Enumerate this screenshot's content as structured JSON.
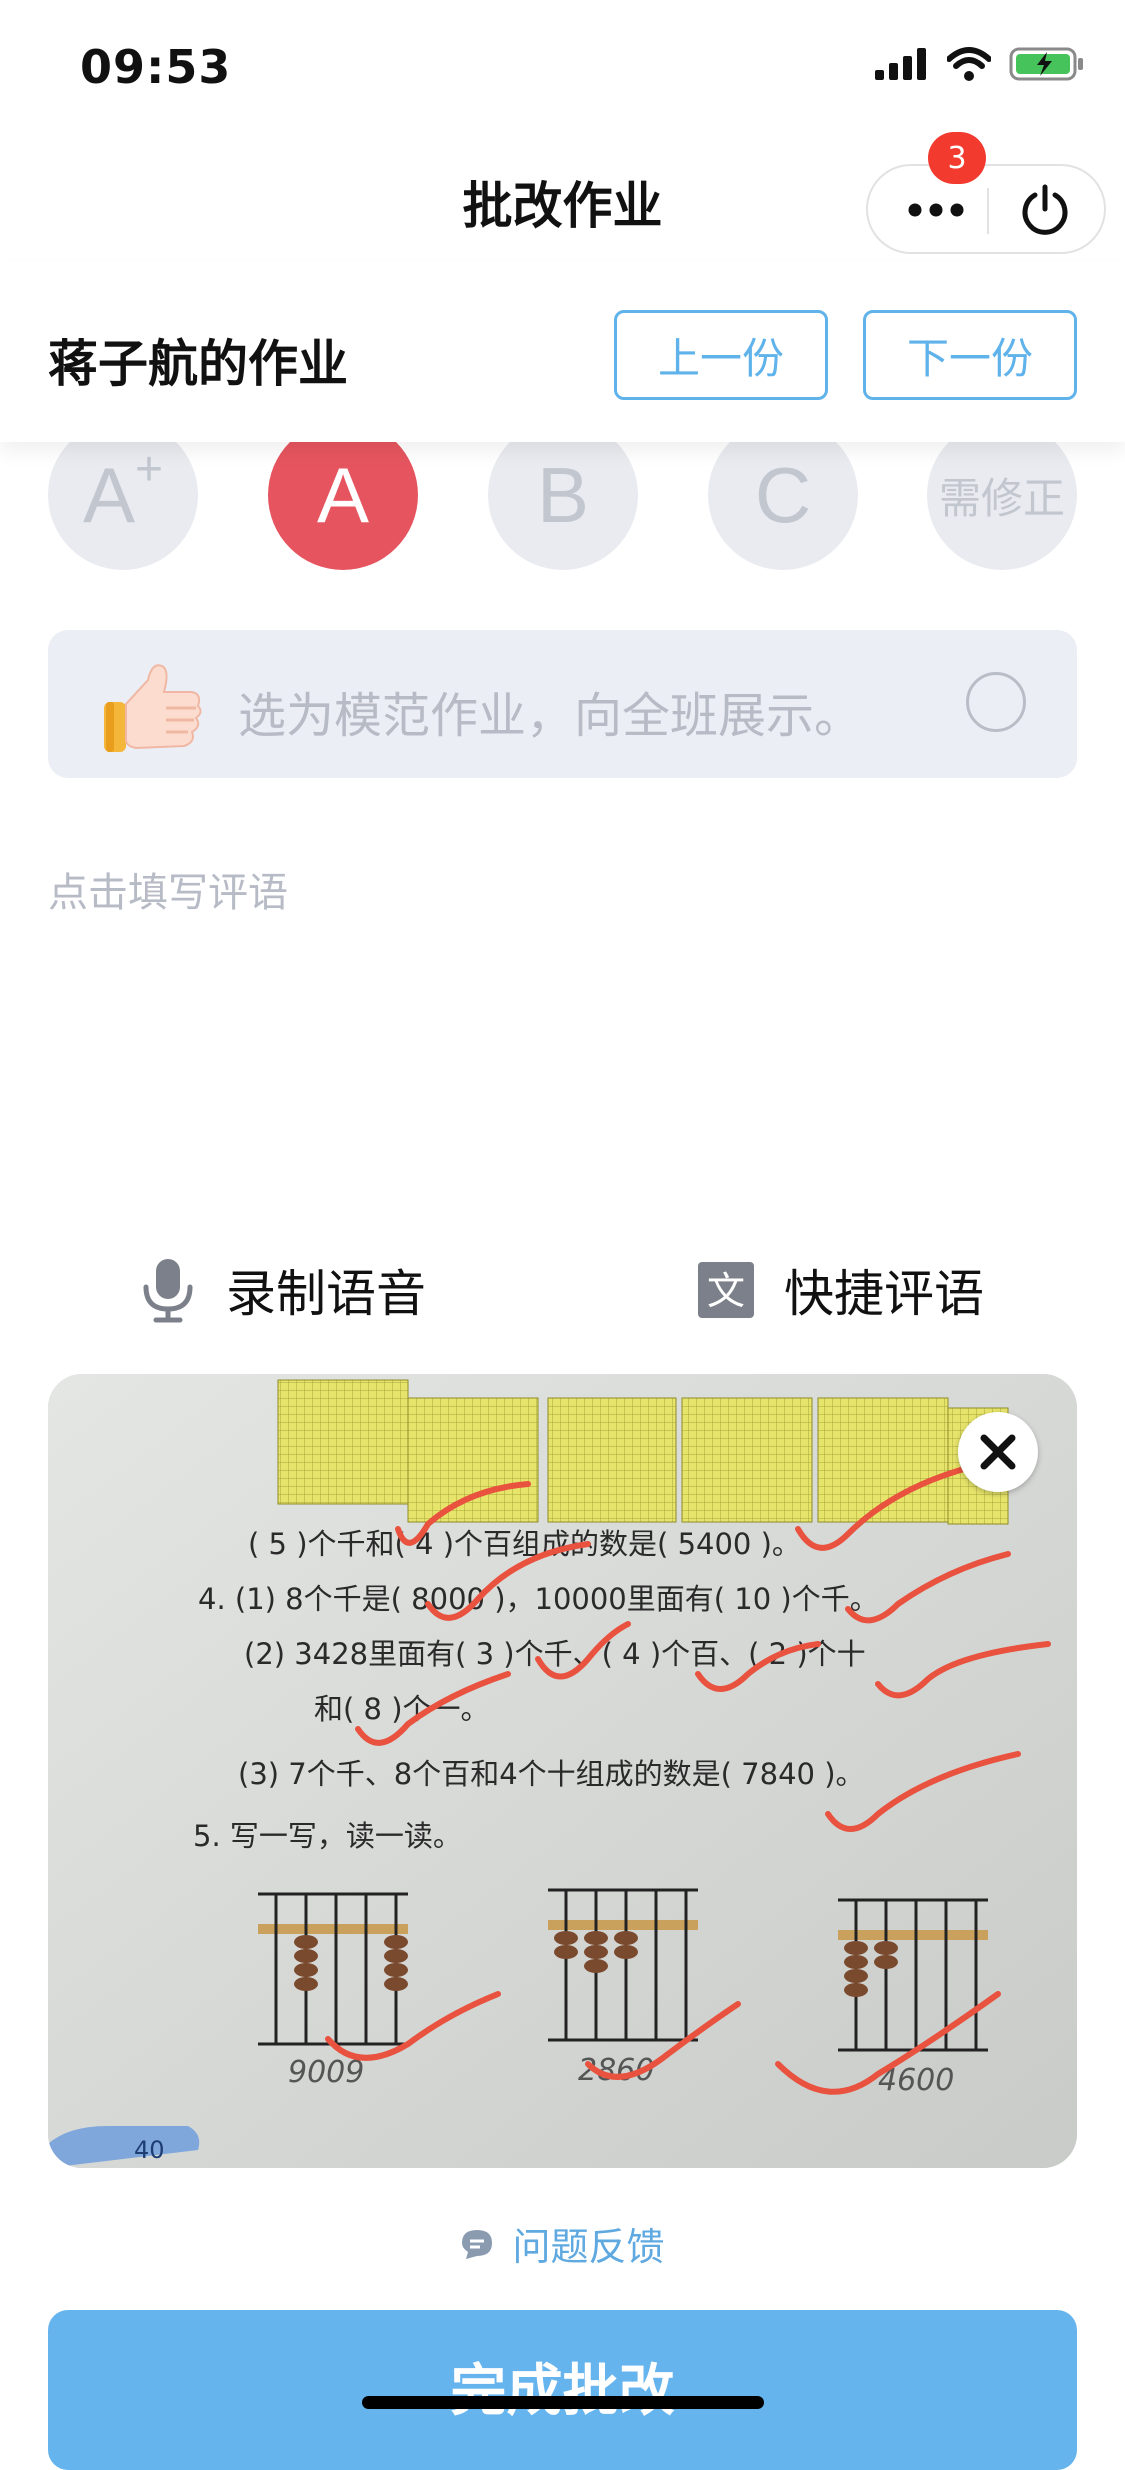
{
  "status_bar": {
    "time": "09:53"
  },
  "nav": {
    "title": "批改作业",
    "badge_count": "3"
  },
  "header": {
    "student_title": "蒋子航的作业",
    "prev_label": "上一份",
    "next_label": "下一份"
  },
  "grades": [
    {
      "label": "A",
      "sup": "+",
      "selected": false
    },
    {
      "label": "A",
      "selected": true
    },
    {
      "label": "B",
      "selected": false
    },
    {
      "label": "C",
      "selected": false
    },
    {
      "label": "需修正",
      "selected": false
    }
  ],
  "exemplar": {
    "text": "选为模范作业，向全班展示。",
    "checked": false
  },
  "comment": {
    "placeholder": "点击填写评语",
    "value": ""
  },
  "tools": {
    "voice_label": "录制语音",
    "quick_label": "快捷评语",
    "quick_icon_char": "文"
  },
  "image": {
    "lines": [
      "( 5 )个千和( 4 )个百组成的数是( 5400 )。",
      "4. (1) 8个千是( 8000 )，10000里面有( 10 )个千。",
      "(2) 3428里面有( 3 )个千、( 4 )个百、( 2 )个十",
      "和( 8 )个一。",
      "(3) 7个千、8个百和4个十组成的数是( 7840 )。",
      "5. 写一写，读一读。"
    ],
    "abacus_answers": [
      "9009",
      "2860",
      "4600"
    ],
    "page_number": "40"
  },
  "feedback": {
    "label": "问题反馈"
  },
  "finish": {
    "label": "完成批改"
  },
  "colors": {
    "accent": "#66b4ee",
    "selected_grade": "#e6555f",
    "badge": "#f23a2f"
  },
  "icons": [
    "signal-icon",
    "wifi-icon",
    "battery-charging-icon",
    "more-icon",
    "power-icon",
    "thumbs-up-icon",
    "microphone-icon",
    "text-icon",
    "close-icon",
    "chat-bubble-icon"
  ]
}
